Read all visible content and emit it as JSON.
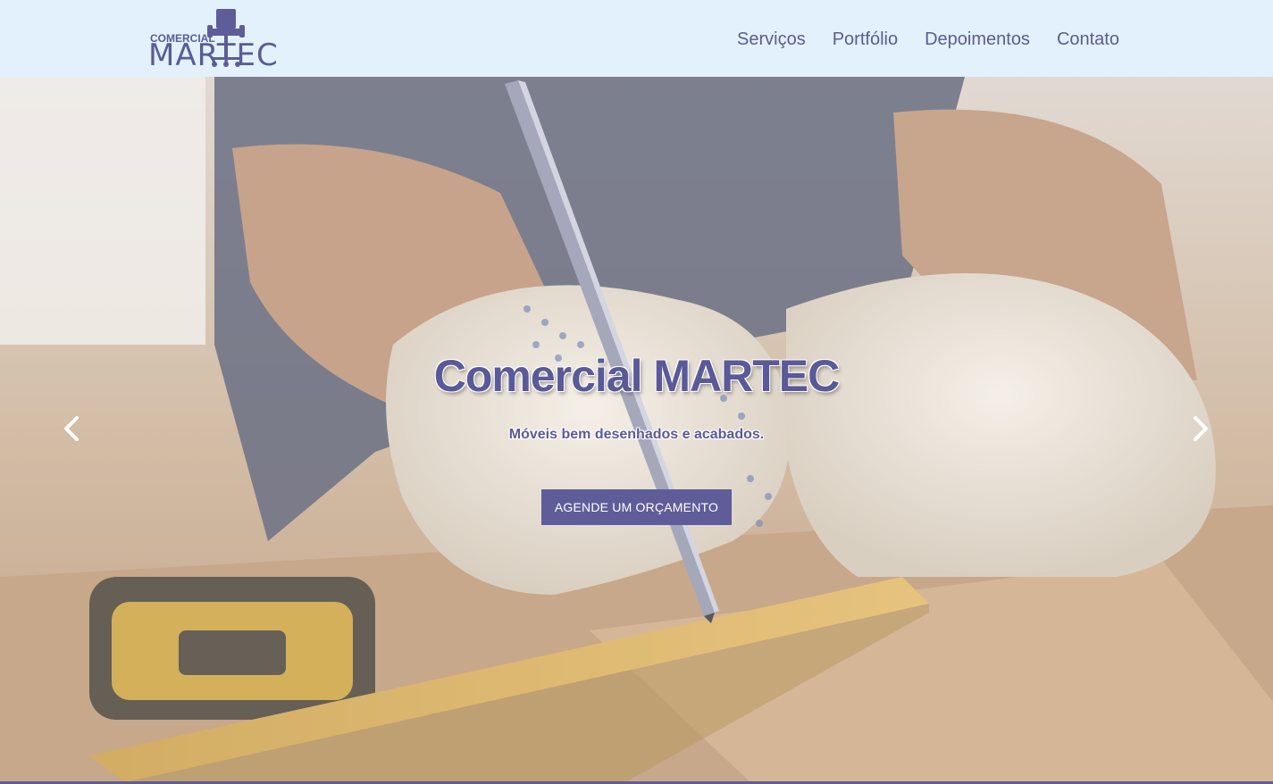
{
  "brand": {
    "logo_top": "COMERCIAL",
    "logo_bottom": "MARTEC",
    "logo_icon": "chair-icon",
    "primary_color": "#5f5d99",
    "nav_bg": "#e3f1fd"
  },
  "nav": {
    "items": [
      {
        "label": "Serviços"
      },
      {
        "label": "Portfólio"
      },
      {
        "label": "Depoimentos"
      },
      {
        "label": "Contato"
      }
    ]
  },
  "hero": {
    "title": "Comercial MARTEC",
    "subtitle": "Móveis bem desenhados e acabados.",
    "cta_label": "AGENDE UM ORÇAMENTO",
    "prev_icon": "chevron-left-icon",
    "next_icon": "chevron-right-icon"
  }
}
